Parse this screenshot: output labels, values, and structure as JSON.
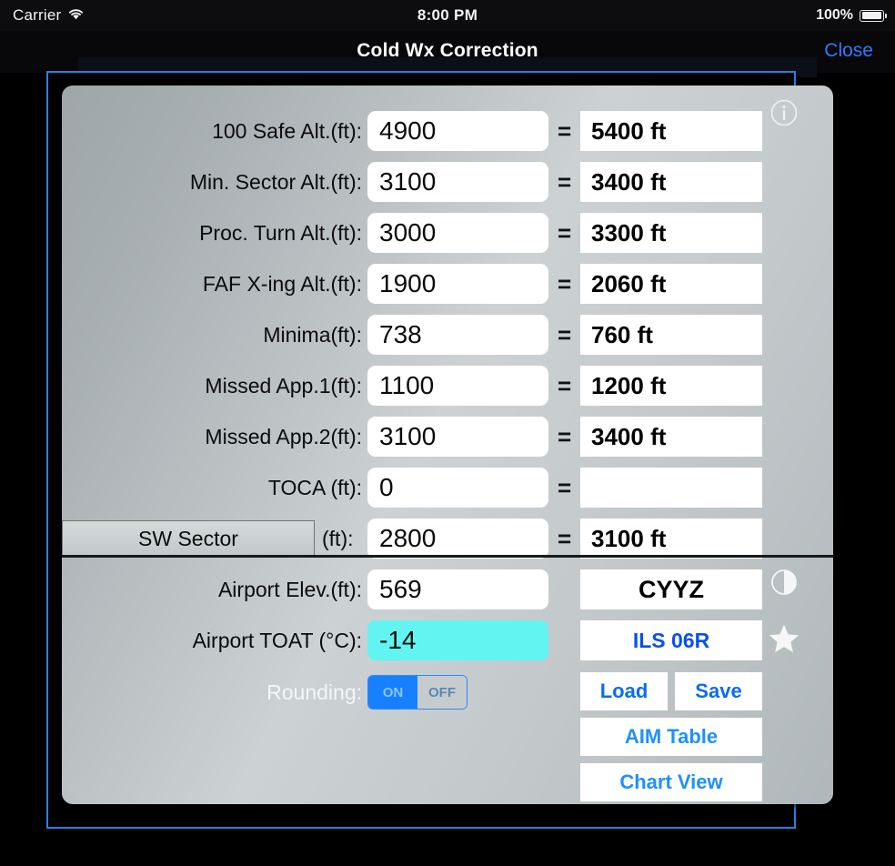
{
  "status_bar": {
    "carrier": "Carrier",
    "wifi_icon": "wifi-icon",
    "time": "8:00 PM",
    "battery_percent": "100%",
    "battery_icon": "battery-full-icon"
  },
  "navbar": {
    "title": "Cold Wx Correction",
    "close_label": "Close"
  },
  "colors": {
    "accent_blue": "#2b7fe0",
    "link_blue": "#0a6bf5",
    "toggle_on": "#1680ff",
    "highlight_teal": "#62f4f0"
  },
  "form": {
    "equals": "=",
    "rows": [
      {
        "label": "100 Safe Alt.(ft):",
        "value": "4900",
        "result": "5400 ft"
      },
      {
        "label": "Min. Sector Alt.(ft):",
        "value": "3100",
        "result": "3400 ft"
      },
      {
        "label": "Proc. Turn Alt.(ft):",
        "value": "3000",
        "result": "3300 ft"
      },
      {
        "label": "FAF X-ing Alt.(ft):",
        "value": "1900",
        "result": "2060 ft"
      },
      {
        "label": "Minima(ft):",
        "value": "738",
        "result": "760 ft"
      },
      {
        "label": "Missed App.1(ft):",
        "value": "1100",
        "result": "1200 ft"
      },
      {
        "label": "Missed App.2(ft):",
        "value": "3100",
        "result": "3400 ft"
      },
      {
        "label": "TOCA (ft):",
        "value": "0",
        "result": ""
      }
    ],
    "sector_row": {
      "sector_button_label": "SW Sector",
      "unit_label": "(ft):",
      "value": "2800",
      "result": "3100 ft"
    }
  },
  "bottom": {
    "airport_elev_label": "Airport Elev.(ft):",
    "airport_elev_value": "569",
    "airport_code": "CYYZ",
    "toat_label": "Airport TOAT (°C):",
    "toat_value": "-14",
    "approach": "ILS 06R",
    "rounding_label": "Rounding:",
    "rounding_on": "ON",
    "rounding_off": "OFF",
    "load_label": "Load",
    "save_label": "Save",
    "aim_table_label": "AIM Table",
    "chart_view_label": "Chart View"
  },
  "icons": {
    "info": "info-circle-icon",
    "contrast": "contrast-icon",
    "favorite": "star-icon"
  }
}
